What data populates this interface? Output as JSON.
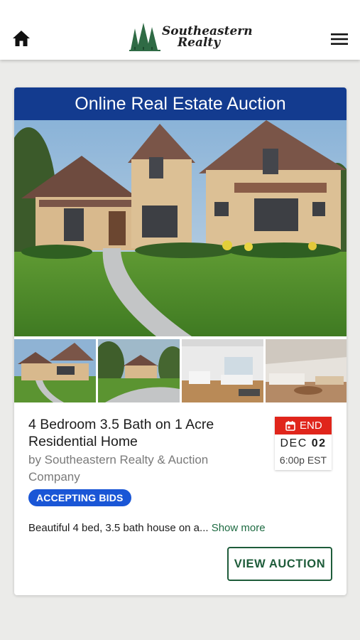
{
  "header": {
    "home_icon": "home-icon",
    "menu_icon": "hamburger-menu-icon",
    "logo_line1": "Southeastern",
    "logo_line2": "Realty"
  },
  "card": {
    "banner": "Online Real Estate Auction",
    "carousel": {
      "slide_count": 4,
      "active_index": 0
    },
    "thumbnails": [
      "house-exterior-front",
      "house-exterior-side",
      "living-room",
      "kitchen-lounge"
    ],
    "title": "4 Bedroom 3.5 Bath on 1 Acre Residential Home",
    "by": "by Southeastern Realty & Auction Company",
    "badge": "ACCEPTING BIDS",
    "end": {
      "label": "END",
      "month": "DEC",
      "day": "02",
      "time": "6:00p EST"
    },
    "description": "Beautiful 4 bed, 3.5 bath house on a...",
    "show_more": "Show more",
    "view_button": "VIEW AUCTION"
  },
  "colors": {
    "banner": "#133b8f",
    "badge": "#1a56d6",
    "end_red": "#e0251b",
    "brand_green": "#1e5c3a",
    "page_bg": "#ebebe9"
  }
}
